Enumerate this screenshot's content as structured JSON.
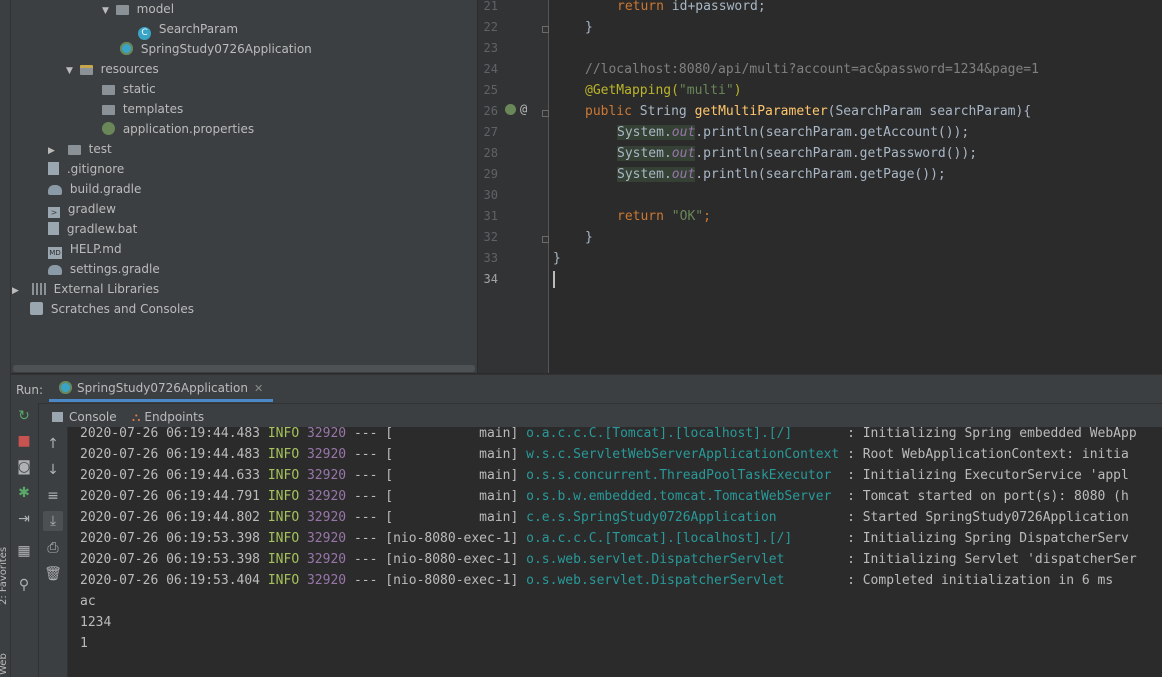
{
  "project_tree": [
    {
      "label": "model",
      "icon": "package-folder-icon",
      "arrow": "▼"
    },
    {
      "label": "SearchParam",
      "icon": "class-icon",
      "arrow": ""
    },
    {
      "label": "SpringStudy0726Application",
      "icon": "spring-boot-class-icon",
      "arrow": ""
    },
    {
      "label": "resources",
      "icon": "resources-folder-icon",
      "arrow": "▼"
    },
    {
      "label": "static",
      "icon": "folder-icon",
      "arrow": ""
    },
    {
      "label": "templates",
      "icon": "folder-icon",
      "arrow": ""
    },
    {
      "label": "application.properties",
      "icon": "properties-file-icon",
      "arrow": ""
    },
    {
      "label": "test",
      "icon": "folder-icon",
      "arrow": "▶"
    },
    {
      "label": ".gitignore",
      "icon": "file-icon",
      "arrow": ""
    },
    {
      "label": "build.gradle",
      "icon": "gradle-icon",
      "arrow": ""
    },
    {
      "label": "gradlew",
      "icon": "terminal-file-icon",
      "arrow": ""
    },
    {
      "label": "gradlew.bat",
      "icon": "file-icon",
      "arrow": ""
    },
    {
      "label": "HELP.md",
      "icon": "markdown-file-icon",
      "arrow": ""
    },
    {
      "label": "settings.gradle",
      "icon": "gradle-icon",
      "arrow": ""
    },
    {
      "label": "External Libraries",
      "icon": "libraries-icon",
      "arrow": "▶"
    },
    {
      "label": "Scratches and Consoles",
      "icon": "scratches-icon",
      "arrow": ""
    }
  ],
  "editor": {
    "line_numbers": [
      "21",
      "22",
      "23",
      "24",
      "25",
      "26",
      "27",
      "28",
      "29",
      "30",
      "31",
      "32",
      "33",
      "34"
    ],
    "current_line": "34",
    "code": {
      "l21_kw": "return",
      "l21_rest": " id+password;",
      "l22": "}",
      "l24_comment": "//localhost:8080/api/multi?account=ac&password=1234&page=1",
      "l25_ann": "@GetMapping(",
      "l25_str": "\"multi\"",
      "l25_end": ")",
      "l26_kw": "public",
      "l26_type": " String ",
      "l26_fn": "getMultiParameter",
      "l26_rest": "(SearchParam searchParam){",
      "sys": "System",
      "dot": ".",
      "out": "out",
      "l27_rest": ".println(searchParam.getAccount());",
      "l28_rest": ".println(searchParam.getPassword());",
      "l29_rest": ".println(searchParam.getPage());",
      "l31_kw": "return",
      "l31_str": " \"OK\"",
      "l31_end": ";",
      "l32": "}",
      "l33": "}"
    },
    "gutter_at": "@"
  },
  "run_panel": {
    "label": "Run:",
    "tab": "SpringStudy0726Application",
    "tab_close": "✕",
    "subtabs": {
      "console": "Console",
      "endpoints": "Endpoints"
    }
  },
  "console": {
    "logs": [
      {
        "ts": "2020-07-26 06:19:44.483",
        "level": "INFO",
        "pid": "32920",
        "sep": "---",
        "thread": "[           main]",
        "logger": "o.a.c.c.C.[Tomcat].[localhost].[/]      ",
        "msg": ": Initializing Spring embedded WebApp"
      },
      {
        "ts": "2020-07-26 06:19:44.483",
        "level": "INFO",
        "pid": "32920",
        "sep": "---",
        "thread": "[           main]",
        "logger": "w.s.c.ServletWebServerApplicationContext",
        "msg": ": Root WebApplicationContext: initia"
      },
      {
        "ts": "2020-07-26 06:19:44.633",
        "level": "INFO",
        "pid": "32920",
        "sep": "---",
        "thread": "[           main]",
        "logger": "o.s.s.concurrent.ThreadPoolTaskExecutor ",
        "msg": ": Initializing ExecutorService 'appl"
      },
      {
        "ts": "2020-07-26 06:19:44.791",
        "level": "INFO",
        "pid": "32920",
        "sep": "---",
        "thread": "[           main]",
        "logger": "o.s.b.w.embedded.tomcat.TomcatWebServer ",
        "msg": ": Tomcat started on port(s): 8080 (h"
      },
      {
        "ts": "2020-07-26 06:19:44.802",
        "level": "INFO",
        "pid": "32920",
        "sep": "---",
        "thread": "[           main]",
        "logger": "c.e.s.SpringStudy0726Application        ",
        "msg": ": Started SpringStudy0726Application"
      },
      {
        "ts": "2020-07-26 06:19:53.398",
        "level": "INFO",
        "pid": "32920",
        "sep": "---",
        "thread": "[nio-8080-exec-1]",
        "logger": "o.a.c.c.C.[Tomcat].[localhost].[/]      ",
        "msg": ": Initializing Spring DispatcherServ"
      },
      {
        "ts": "2020-07-26 06:19:53.398",
        "level": "INFO",
        "pid": "32920",
        "sep": "---",
        "thread": "[nio-8080-exec-1]",
        "logger": "o.s.web.servlet.DispatcherServlet       ",
        "msg": ": Initializing Servlet 'dispatcherSer"
      },
      {
        "ts": "2020-07-26 06:19:53.404",
        "level": "INFO",
        "pid": "32920",
        "sep": "---",
        "thread": "[nio-8080-exec-1]",
        "logger": "o.s.web.servlet.DispatcherServlet       ",
        "msg": ": Completed initialization in 6 ms"
      }
    ],
    "output": [
      "ac",
      "1234",
      "1"
    ]
  },
  "favorites_label": "2: Favorites",
  "web_label": "Web"
}
